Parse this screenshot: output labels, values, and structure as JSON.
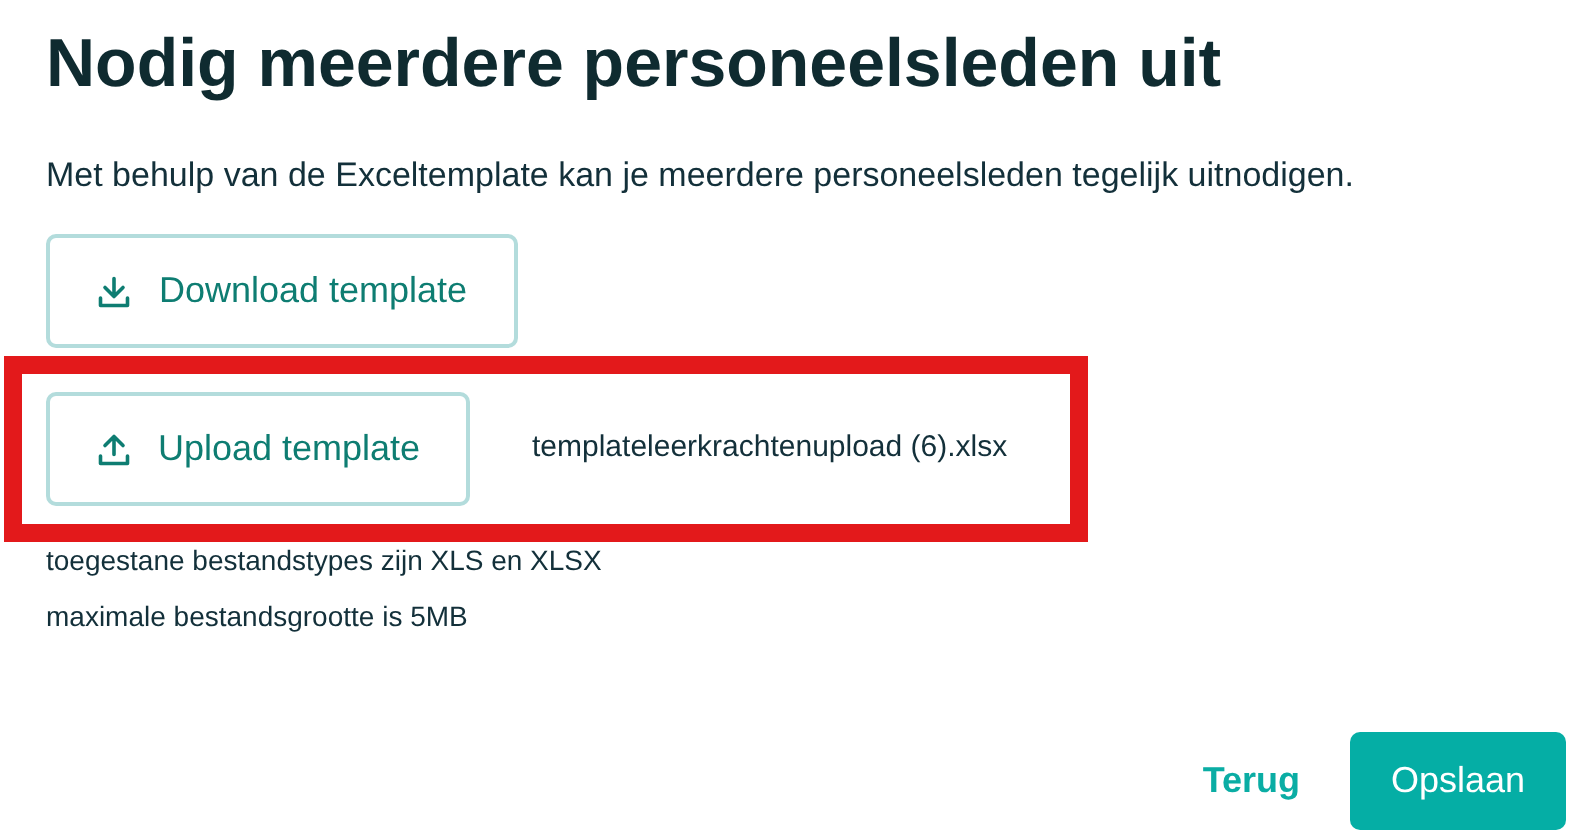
{
  "title": "Nodig meerdere personeelsleden uit",
  "intro": "Met behulp van de Exceltemplate kan je meerdere personeelsleden tegelijk uitnodigen.",
  "download_button": {
    "label": "Download template"
  },
  "upload": {
    "button": "Upload template",
    "file_name": "templateleerkrachtenupload (6).xlsx",
    "highlighted": true
  },
  "notes": [
    "toegestane bestandstypes zijn XLS en XLSX",
    "maximale bestandsgrootte is 5MB"
  ],
  "footer": {
    "back": "Terug",
    "save": "Opslaan"
  }
}
